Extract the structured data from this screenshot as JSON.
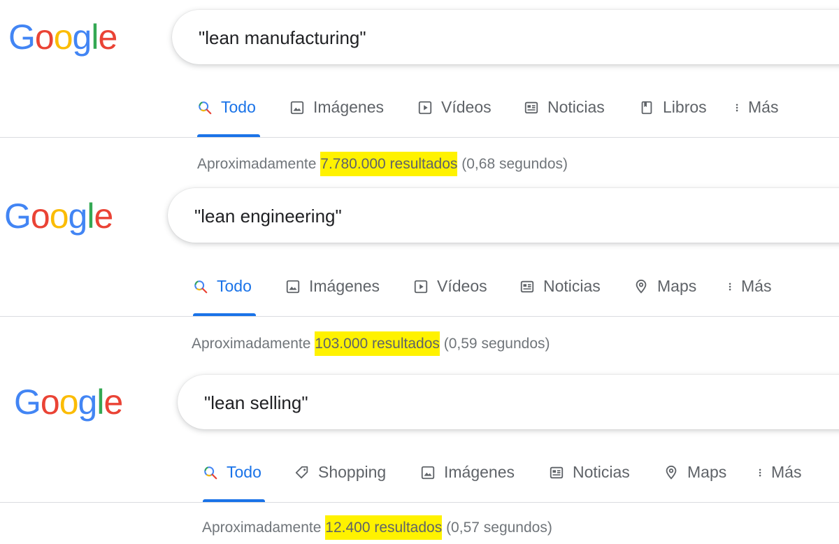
{
  "colors": {
    "google_blue": "#4285F4",
    "google_red": "#EA4335",
    "google_yellow": "#FBBC05",
    "google_green": "#34A853",
    "tab_active": "#1a73e8",
    "highlight": "#fff200"
  },
  "blocks": [
    {
      "logo": "Google",
      "query": "\"lean manufacturing\"",
      "tabs": [
        {
          "label": "Todo",
          "icon": "search-icon",
          "active": true
        },
        {
          "label": "Imágenes",
          "icon": "image-icon"
        },
        {
          "label": "Vídeos",
          "icon": "play-icon"
        },
        {
          "label": "Noticias",
          "icon": "news-icon"
        },
        {
          "label": "Libros",
          "icon": "book-icon"
        },
        {
          "label": "Más",
          "icon": "more-icon"
        }
      ],
      "stats": {
        "prefix": "Aproximadamente ",
        "count": "7.780.000 resultados",
        "suffix": " (0,68 segundos)"
      }
    },
    {
      "logo": "Google",
      "query": "\"lean engineering\"",
      "tabs": [
        {
          "label": "Todo",
          "icon": "search-icon",
          "active": true
        },
        {
          "label": "Imágenes",
          "icon": "image-icon"
        },
        {
          "label": "Vídeos",
          "icon": "play-icon"
        },
        {
          "label": "Noticias",
          "icon": "news-icon"
        },
        {
          "label": "Maps",
          "icon": "map-pin-icon"
        },
        {
          "label": "Más",
          "icon": "more-icon"
        }
      ],
      "stats": {
        "prefix": "Aproximadamente ",
        "count": "103.000 resultados",
        "suffix": " (0,59 segundos)"
      }
    },
    {
      "logo": "Google",
      "query": "\"lean selling\"",
      "tabs": [
        {
          "label": "Todo",
          "icon": "search-icon",
          "active": true
        },
        {
          "label": "Shopping",
          "icon": "tag-icon"
        },
        {
          "label": "Imágenes",
          "icon": "image-icon"
        },
        {
          "label": "Noticias",
          "icon": "news-icon"
        },
        {
          "label": "Maps",
          "icon": "map-pin-icon"
        },
        {
          "label": "Más",
          "icon": "more-icon"
        }
      ],
      "stats": {
        "prefix": "Aproximadamente ",
        "count": "12.400 resultados",
        "suffix": " (0,57 segundos)"
      }
    }
  ]
}
